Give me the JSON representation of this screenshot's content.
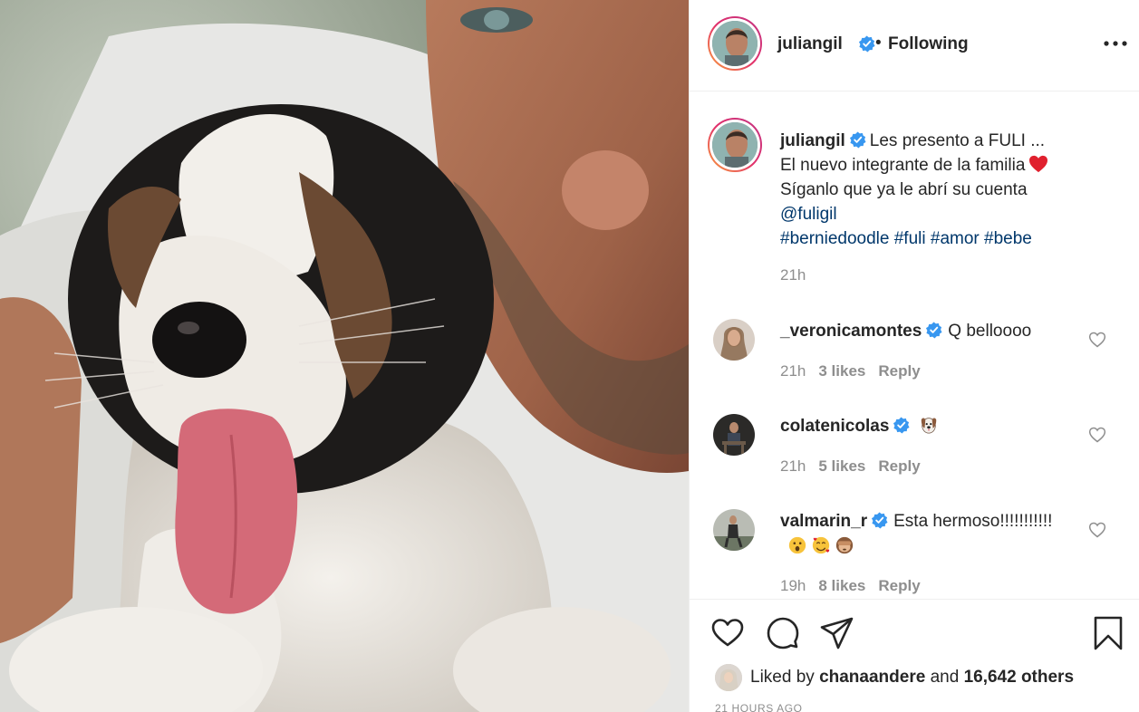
{
  "post": {
    "author": "juliangil",
    "follow_status": "Following",
    "separator": "•"
  },
  "caption": {
    "username": "juliangil",
    "line1": "Les presento a FULI ...",
    "line2": "El nuevo integrante de la familia",
    "line3": "Síganlo que ya le abrí su cuenta",
    "mention": "@fuligil",
    "hashtags": [
      "#berniedoodle",
      "#fuli",
      "#amor",
      "#bebe"
    ],
    "time": "21h"
  },
  "comments": [
    {
      "username": "_veronicamontes",
      "text": "Q belloooo",
      "time": "21h",
      "likes": "3 likes",
      "reply": "Reply"
    },
    {
      "username": "colatenicolas",
      "text": "",
      "time": "21h",
      "likes": "5 likes",
      "reply": "Reply"
    },
    {
      "username": "valmarin_r",
      "text": "Esta hermoso!!!!!!!!!!!",
      "time": "19h",
      "likes": "8 likes",
      "reply": "Reply"
    }
  ],
  "likes": {
    "prefix": "Liked by",
    "user": "chanaandere",
    "joiner": "and",
    "others": "16,642 others"
  },
  "timestamp": "21 HOURS AGO",
  "icons": {
    "verified": "verified-badge-icon",
    "more": "more-options-icon",
    "like": "heart-icon",
    "comment": "comment-bubble-icon",
    "share": "paper-plane-icon",
    "save": "bookmark-icon",
    "comment_like": "small-heart-icon"
  },
  "colors": {
    "verified_blue": "#3897f0",
    "link": "#00376b",
    "meta_gray": "#8e8e8e",
    "text": "#262626"
  }
}
